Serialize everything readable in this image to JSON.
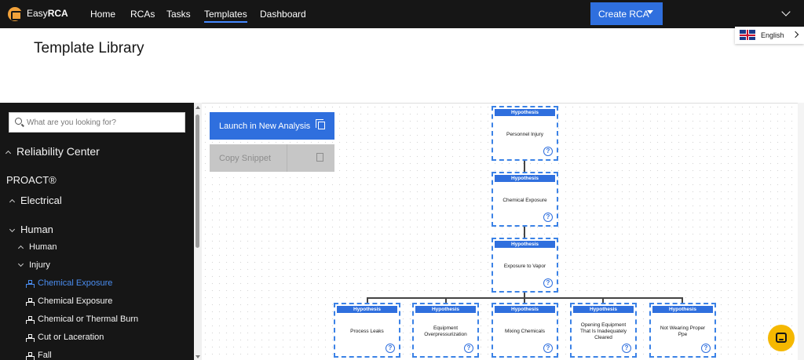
{
  "app": {
    "brand_prefix": "Easy",
    "brand_suffix": "RCA"
  },
  "nav": {
    "items": [
      {
        "label": "Home"
      },
      {
        "label": "RCAs"
      },
      {
        "label": "Tasks"
      },
      {
        "label": "Templates",
        "active": true
      },
      {
        "label": "Dashboard"
      }
    ],
    "create_label": "Create RCA"
  },
  "language": {
    "label": "English"
  },
  "page": {
    "title": "Template Library"
  },
  "sidebar": {
    "search_placeholder": "What are you looking for?",
    "items": [
      {
        "label": "Reliability Center"
      },
      {
        "label": "PROACT®"
      },
      {
        "label": "Electrical"
      },
      {
        "label": "Human"
      },
      {
        "label": "Human"
      },
      {
        "label": "Injury"
      },
      {
        "label": "Chemical Exposure",
        "selected": true
      },
      {
        "label": "Chemical Exposure"
      },
      {
        "label": "Chemical or Thermal Burn"
      },
      {
        "label": "Cut or Laceration"
      },
      {
        "label": "Fall"
      }
    ]
  },
  "actions": {
    "launch_label": "Launch in New Analysis",
    "copy_label": "Copy Snippet"
  },
  "tree": {
    "node_header": "Hypothesis",
    "help_symbol": "?",
    "nodes": [
      {
        "text": "Personnel Injury"
      },
      {
        "text": "Chemical Exposure"
      },
      {
        "text": "Exposure to Vapor"
      },
      {
        "text": "Process Leaks"
      },
      {
        "text": "Equipment Overpressurization"
      },
      {
        "text": "Mixing Chemicals"
      },
      {
        "text": "Opening Equipment That Is Inadequately Cleared"
      },
      {
        "text": "Not Wearing Proper Ppe"
      }
    ]
  },
  "colors": {
    "accent": "#2f6fde",
    "nav_bg": "#161616",
    "sidebar_bg": "#161616",
    "selected": "#4a8df0",
    "chat": "#f5b800"
  }
}
